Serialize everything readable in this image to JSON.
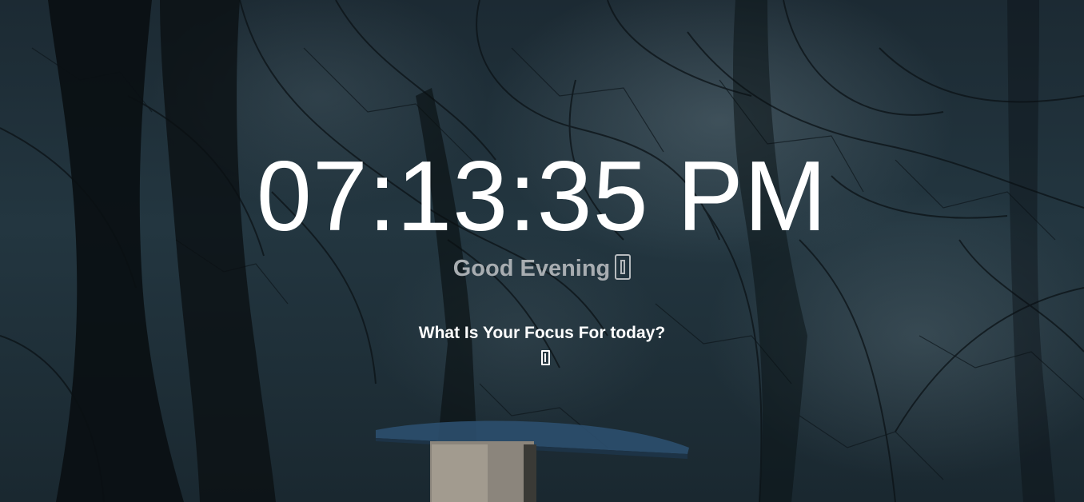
{
  "background": {
    "icon": "forest-background-image",
    "colors": {
      "sky": "#233640",
      "dark": "#0d1418",
      "feeder_roof": "#2c4f6e"
    }
  },
  "clock": {
    "time": "07:13:35 PM"
  },
  "greeting": {
    "text": "Good Evening",
    "edit_icon": "edit-name-icon"
  },
  "focus": {
    "question": "What Is Your Focus For today?",
    "value": "",
    "placeholder": ""
  }
}
